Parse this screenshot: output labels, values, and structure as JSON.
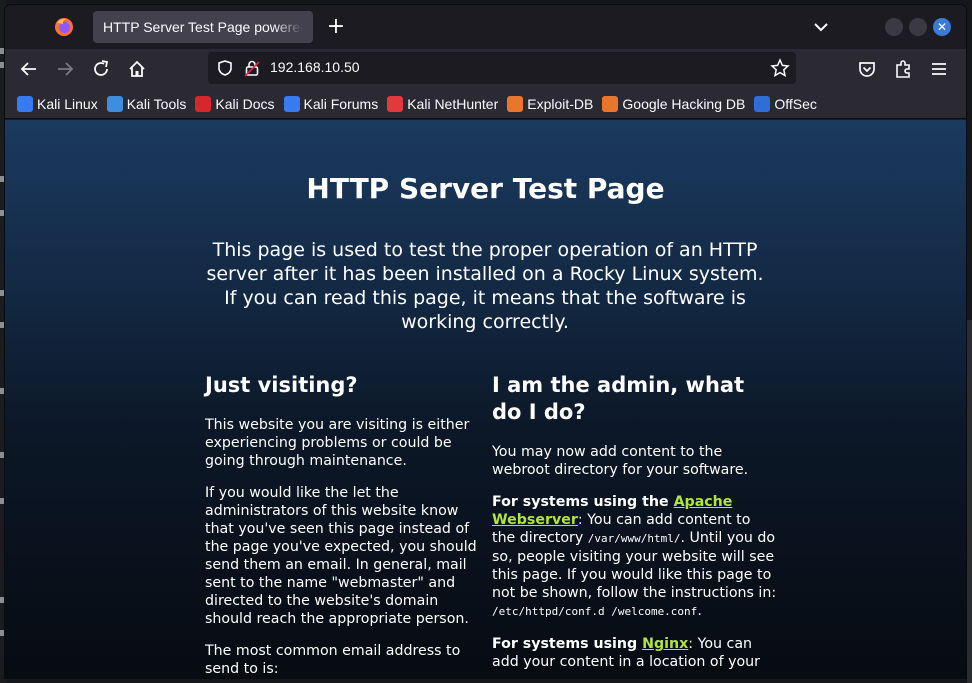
{
  "browser": {
    "tab_title": "HTTP Server Test Page powered by Rocky Linux",
    "url": "192.168.10.50",
    "new_tab_label": "+"
  },
  "bookmarks": [
    {
      "label": "Kali Linux",
      "icon": "kali-linux-icon",
      "color": "#367bf0"
    },
    {
      "label": "Kali Tools",
      "icon": "kali-tools-icon",
      "color": "#3e8ee0"
    },
    {
      "label": "Kali Docs",
      "icon": "kali-docs-icon",
      "color": "#d9262c"
    },
    {
      "label": "Kali Forums",
      "icon": "kali-forums-icon",
      "color": "#367bf0"
    },
    {
      "label": "Kali NetHunter",
      "icon": "kali-nethunter-icon",
      "color": "#e0393e"
    },
    {
      "label": "Exploit-DB",
      "icon": "exploit-db-icon",
      "color": "#e8762d"
    },
    {
      "label": "Google Hacking DB",
      "icon": "ghdb-icon",
      "color": "#e8762d"
    },
    {
      "label": "OffSec",
      "icon": "offsec-icon",
      "color": "#2d6fd6"
    }
  ],
  "page": {
    "title": "HTTP Server Test Page",
    "lead": "This page is used to test the proper operation of an HTTP server after it has been installed on a Rocky Linux system. If you can read this page, it means that the software is working correctly.",
    "left": {
      "heading": "Just visiting?",
      "p1": "This website you are visiting is either experiencing problems or could be going through maintenance.",
      "p2": "If you would like the let the administrators of this website know that you've seen this page instead of the page you've expected, you should send them an email. In general, mail sent to the name \"webmaster\" and directed to the website's domain should reach the appropriate person.",
      "p3": "The most common email address to send to is:"
    },
    "right": {
      "heading": "I am the admin, what do I do?",
      "p1": "You may now add content to the webroot directory for your software.",
      "apache_prefix": "For systems using the ",
      "apache_link": "Apache Webserver",
      "apache_text1": ": You can add content to the directory ",
      "apache_code1": "/var/www/html/",
      "apache_text2": ". Until you do so, people visiting your website will see this page. If you would like this page to not be shown, follow the instructions in: ",
      "apache_code2": "/etc/httpd/conf.d /welcome.conf",
      "apache_text3": ".",
      "nginx_prefix": "For systems using ",
      "nginx_link": "Nginx",
      "nginx_text": ": You can add your content in a location of your"
    }
  },
  "colors": {
    "link": "#b2e53c",
    "close_button": "#3a7bd5"
  }
}
